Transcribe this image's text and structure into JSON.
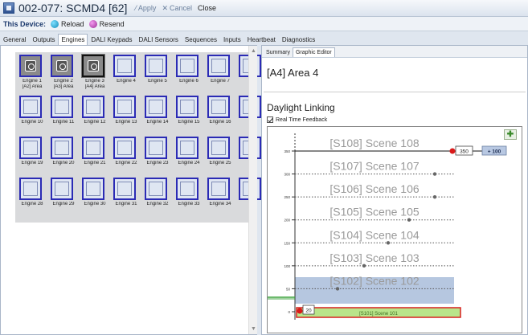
{
  "window": {
    "title": "002-077: SCMD4 [62]",
    "apply_label": "Apply",
    "cancel_label": "Cancel",
    "close_label": "Close"
  },
  "device_bar": {
    "label": "This Device:",
    "reload_label": "Reload",
    "resend_label": "Resend"
  },
  "tabs": [
    {
      "label": "General",
      "active": false
    },
    {
      "label": "Outputs",
      "active": false
    },
    {
      "label": "Engines",
      "active": true
    },
    {
      "label": "DALI Keypads",
      "active": false
    },
    {
      "label": "DALI Sensors",
      "active": false
    },
    {
      "label": "Sequences",
      "active": false
    },
    {
      "label": "Inputs",
      "active": false
    },
    {
      "label": "Heartbeat",
      "active": false
    },
    {
      "label": "Diagnostics",
      "active": false
    }
  ],
  "engines": [
    {
      "name": "Engine 1",
      "area": "[A2] Area",
      "used": true,
      "selected": false
    },
    {
      "name": "Engine 2",
      "area": "[A3] Area",
      "used": true,
      "selected": false
    },
    {
      "name": "Engine 3",
      "area": "[A4] Area",
      "used": true,
      "selected": true
    },
    {
      "name": "Engine 4",
      "area": "",
      "used": false,
      "selected": false
    },
    {
      "name": "Engine 5",
      "area": "",
      "used": false,
      "selected": false
    },
    {
      "name": "Engine 6",
      "area": "",
      "used": false,
      "selected": false
    },
    {
      "name": "Engine 7",
      "area": "",
      "used": false,
      "selected": false
    },
    {
      "name": "E",
      "area": "",
      "used": false,
      "selected": false
    },
    {
      "name": "Engine 10",
      "area": "",
      "used": false,
      "selected": false
    },
    {
      "name": "Engine 11",
      "area": "",
      "used": false,
      "selected": false
    },
    {
      "name": "Engine 12",
      "area": "",
      "used": false,
      "selected": false
    },
    {
      "name": "Engine 13",
      "area": "",
      "used": false,
      "selected": false
    },
    {
      "name": "Engine 14",
      "area": "",
      "used": false,
      "selected": false
    },
    {
      "name": "Engine 15",
      "area": "",
      "used": false,
      "selected": false
    },
    {
      "name": "Engine 16",
      "area": "",
      "used": false,
      "selected": false
    },
    {
      "name": "E",
      "area": "",
      "used": false,
      "selected": false
    },
    {
      "name": "Engine 19",
      "area": "",
      "used": false,
      "selected": false
    },
    {
      "name": "Engine 20",
      "area": "",
      "used": false,
      "selected": false
    },
    {
      "name": "Engine 21",
      "area": "",
      "used": false,
      "selected": false
    },
    {
      "name": "Engine 22",
      "area": "",
      "used": false,
      "selected": false
    },
    {
      "name": "Engine 23",
      "area": "",
      "used": false,
      "selected": false
    },
    {
      "name": "Engine 24",
      "area": "",
      "used": false,
      "selected": false
    },
    {
      "name": "Engine 25",
      "area": "",
      "used": false,
      "selected": false
    },
    {
      "name": "E",
      "area": "",
      "used": false,
      "selected": false
    },
    {
      "name": "Engine 28",
      "area": "",
      "used": false,
      "selected": false
    },
    {
      "name": "Engine 29",
      "area": "",
      "used": false,
      "selected": false
    },
    {
      "name": "Engine 30",
      "area": "",
      "used": false,
      "selected": false
    },
    {
      "name": "Engine 31",
      "area": "",
      "used": false,
      "selected": false
    },
    {
      "name": "Engine 32",
      "area": "",
      "used": false,
      "selected": false
    },
    {
      "name": "Engine 33",
      "area": "",
      "used": false,
      "selected": false
    },
    {
      "name": "Engine 34",
      "area": "",
      "used": false,
      "selected": false
    },
    {
      "name": "E",
      "area": "",
      "used": false,
      "selected": false
    }
  ],
  "right_panel": {
    "subtabs": [
      {
        "label": "Summary",
        "active": false
      },
      {
        "label": "Graphic Editor",
        "active": true
      }
    ],
    "area_title": "[A4] Area 4",
    "section_title": "Daylight Linking",
    "realtime_label": "Real Time Feedback",
    "realtime_checked": true
  },
  "daylight_graph": {
    "y_ticks": [
      "350",
      "300",
      "250",
      "200",
      "150",
      "100",
      "50",
      "0"
    ],
    "scenes": [
      {
        "label": "[S108] Scene 108",
        "level": 350,
        "style": "solid"
      },
      {
        "label": "[S107] Scene 107",
        "level": 300,
        "style": "dotted"
      },
      {
        "label": "[S106] Scene 106",
        "level": 250,
        "style": "dotted"
      },
      {
        "label": "[S105] Scene 105",
        "level": 200,
        "style": "dotted"
      },
      {
        "label": "[S104] Scene 104",
        "level": 150,
        "style": "dotted"
      },
      {
        "label": "[S103] Scene 103",
        "level": 100,
        "style": "dotted"
      },
      {
        "label": "[S102] Scene 102",
        "level": 50,
        "style": "highlight"
      },
      {
        "label": "[S101] Scene 101",
        "level": 0,
        "style": "active"
      }
    ],
    "top_marker_value": "350",
    "top_offset_label": "+ 100",
    "bottom_marker_value": "20",
    "colors": {
      "highlight": "#b6c7e0",
      "active_fill": "#b9e58a",
      "active_border": "#d92020",
      "marker": "#d91a1a",
      "offset_box": "#b8c8e2",
      "scene_text": "#9a9a9a"
    }
  }
}
